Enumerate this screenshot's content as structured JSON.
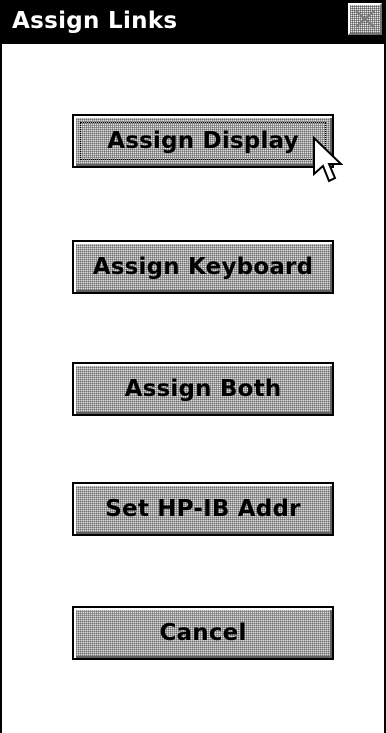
{
  "window": {
    "title": "Assign Links"
  },
  "buttons": {
    "assign_display": "Assign Display",
    "assign_keyboard": "Assign Keyboard",
    "assign_both": "Assign Both",
    "set_hpib_addr": "Set HP-IB Addr",
    "cancel": "Cancel"
  },
  "icons": {
    "close": "close-icon",
    "cursor": "mouse-pointer-icon"
  },
  "colors": {
    "titlebar": "#000000",
    "title_text": "#ffffff",
    "button_face": "#dcdcdc"
  }
}
